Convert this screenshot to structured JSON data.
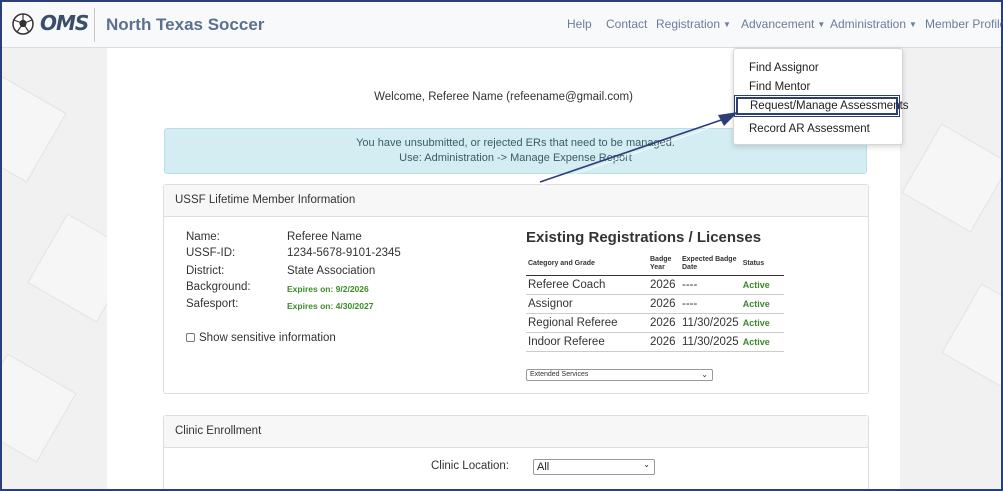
{
  "navbar": {
    "logo_text": "OMS",
    "brand": "North Texas Soccer",
    "links": {
      "help": "Help",
      "contact": "Contact",
      "registration": "Registration",
      "advancement": "Advancement",
      "administration": "Administration",
      "member_profile": "Member Profile"
    }
  },
  "dropdown": {
    "items": [
      "Find Assignor",
      "Find Mentor",
      "Request/Manage Assessments",
      "Record AR Assessment"
    ],
    "highlighted_index": 2
  },
  "welcome": "Welcome, Referee Name (refeename@gmail.com)",
  "alert": {
    "line1": "You have unsubmitted, or rejected ERs that need to be managed.",
    "line2": "Use: Administration -> Manage Expense Report"
  },
  "member_card": {
    "header": "USSF Lifetime Member Information",
    "fields": [
      {
        "label": "Name:",
        "value": "Referee Name"
      },
      {
        "label": "USSF-ID:",
        "value": "1234-5678-9101-2345"
      },
      {
        "label": "District:",
        "value": "State Association"
      },
      {
        "label": "Background:",
        "value": "Expires on: 9/2/2026"
      },
      {
        "label": "Safesport:",
        "value": "Expires on: 4/30/2027"
      }
    ],
    "show_sensitive": "Show sensitive information",
    "registrations_title": "Existing Registrations / Licenses",
    "table_headers": [
      "Category and Grade",
      "Badge Year",
      "Expected Badge Date",
      "Status"
    ],
    "rows": [
      [
        "Referee Coach",
        "2026",
        "----",
        "Active"
      ],
      [
        "Assignor",
        "2026",
        "----",
        "Active"
      ],
      [
        "Regional Referee",
        "2026",
        "11/30/2025",
        "Active"
      ],
      [
        "Indoor Referee",
        "2026",
        "11/30/2025",
        "Active"
      ]
    ],
    "services_select": "Extended Services"
  },
  "clinic_card": {
    "header": "Clinic Enrollment",
    "location_label": "Clinic Location:",
    "location_value": "All"
  },
  "colors": {
    "accent_border": "#2c3e7a",
    "status_green": "#3c8a2a",
    "alert_bg": "#d3edf3"
  }
}
